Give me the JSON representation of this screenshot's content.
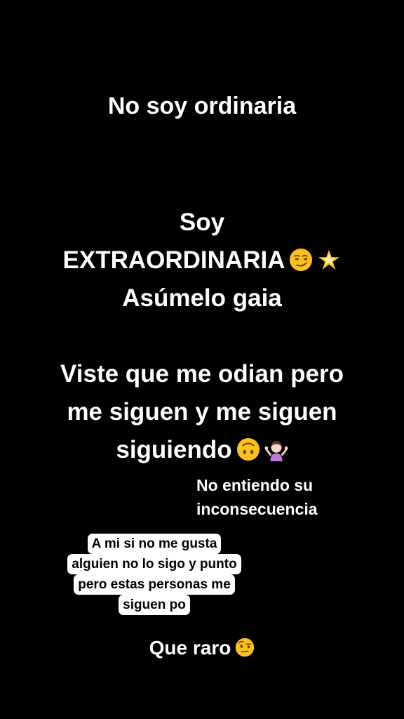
{
  "story": {
    "line1": "No soy ordinaria",
    "block2": {
      "line1": "Soy",
      "line2": "EXTRAORDINARIA",
      "line2_emojis": [
        "smirking-face-emoji",
        "glowing-star-emoji"
      ],
      "line3": "Asúmelo gaia"
    },
    "block3": {
      "line1": "Viste que me odian pero",
      "line2": "me siguen y me siguen",
      "line3": "siguiendo",
      "line3_emojis": [
        "upside-down-face-emoji",
        "person-shrugging-emoji"
      ]
    },
    "note": {
      "line1": "No entiendo su",
      "line2": "inconsecuencia"
    },
    "bubble": {
      "lines": [
        "A mi si no me gusta",
        "alguien no lo sigo y punto",
        "pero estas personas me",
        "siguen po"
      ],
      "background": "#ffffff",
      "text_color": "#000000"
    },
    "final": {
      "text": "Que raro",
      "emoji": "face-with-raised-eyebrow-emoji"
    }
  },
  "colors": {
    "background": "#000000",
    "text": "#ffffff",
    "emoji_yellow": "#fcc21b"
  }
}
